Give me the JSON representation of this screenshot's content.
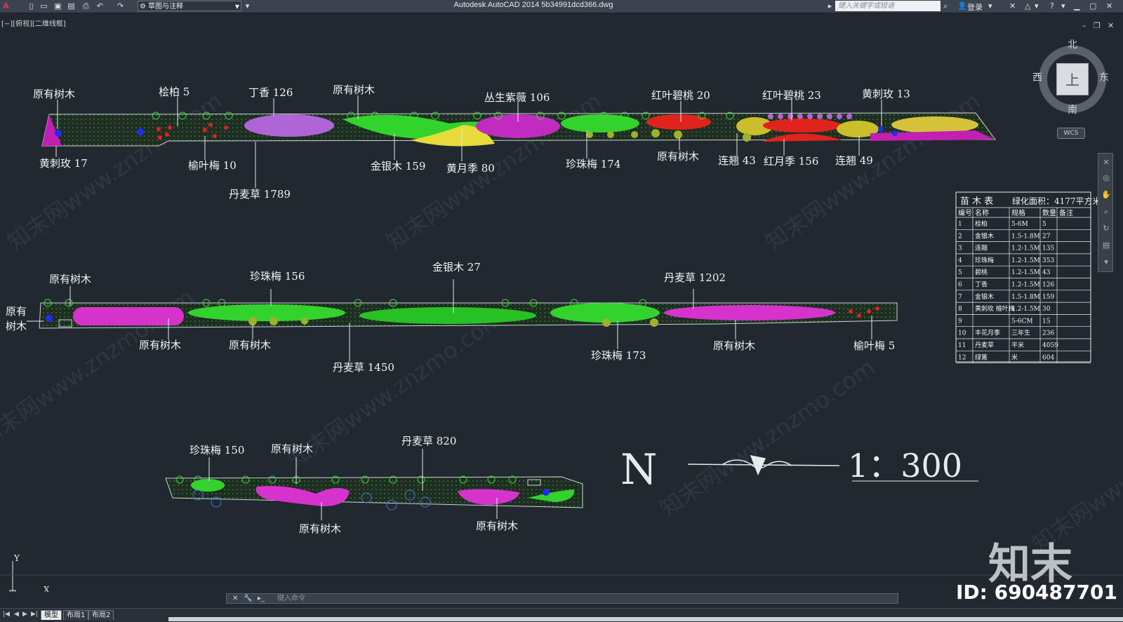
{
  "app": {
    "title": "Autodesk AutoCAD 2014    5b34991dcd366.dwg",
    "workspace": "草图与注释",
    "search_placeholder": "键入关键字或短语",
    "login": "登录",
    "viewport_label": "[−][俯视][二维线框]"
  },
  "viewcube": {
    "north": "北",
    "south": "南",
    "west": "西",
    "east": "东",
    "top": "上",
    "wcs": "WCS"
  },
  "drawing": {
    "strip1_labels": [
      "原有树木",
      "桧柏  5",
      "丁香  126",
      "原有树木",
      "丛生紫薇  106",
      "红叶碧桃  20",
      "红叶碧桃  23",
      "黄刺玫  13",
      "黄刺玫  17",
      "榆叶梅  10",
      "丹麦草  1789",
      "金银木  159",
      "黄月季  80",
      "珍珠梅  174",
      "原有树木",
      "连翘  43",
      "红月季  156",
      "连翘  49"
    ],
    "strip2_labels": [
      "原有树木",
      "珍珠梅  156",
      "金银木  27",
      "丹麦草  1202",
      "原有",
      "树木",
      "原有树木",
      "原有树木",
      "丹麦草  1450",
      "珍珠梅  173",
      "原有树木",
      "榆叶梅  5"
    ],
    "strip3_labels": [
      "珍珠梅  150",
      "原有树木",
      "丹麦草  820",
      "原有树木",
      "原有树木"
    ],
    "north": "N",
    "scale": "1：300"
  },
  "table": {
    "title": "苗  木  表",
    "area": "绿化面积：4177平方米",
    "headers": [
      "编号",
      "名称",
      "规格",
      "数量",
      "备注"
    ],
    "rows": [
      [
        "1",
        "桧柏",
        "5-6M",
        "5",
        ""
      ],
      [
        "2",
        "金银木",
        "1.5-1.8M",
        "27",
        ""
      ],
      [
        "3",
        "连翘",
        "1.2-1.5M",
        "135",
        ""
      ],
      [
        "4",
        "珍珠梅",
        "1.2-1.5M",
        "353",
        ""
      ],
      [
        "5",
        "碧桃",
        "1.2-1.5M",
        "43",
        ""
      ],
      [
        "6",
        "丁香",
        "1.2-1.5M",
        "126",
        ""
      ],
      [
        "7",
        "金银木",
        "1.5-1.8M",
        "159",
        ""
      ],
      [
        "8",
        "黄刺玫 榆叶梅",
        "1.2-1.5M",
        "30",
        ""
      ],
      [
        "9",
        "",
        "5-6CM",
        "15",
        ""
      ],
      [
        "10",
        "丰花月季",
        "三年生",
        "236",
        ""
      ],
      [
        "11",
        "丹麦草",
        "平米",
        "4059",
        ""
      ],
      [
        "12",
        "绿篱",
        "米",
        "604",
        ""
      ]
    ]
  },
  "ucs": {
    "x": "X",
    "y": "Y"
  },
  "command": {
    "placeholder": "键入命令"
  },
  "layout_tabs": [
    "模型",
    "布局1",
    "布局2"
  ],
  "watermark": {
    "logo": "知末",
    "id": "ID: 690487701",
    "text": "知末网www.znzmo.com"
  }
}
